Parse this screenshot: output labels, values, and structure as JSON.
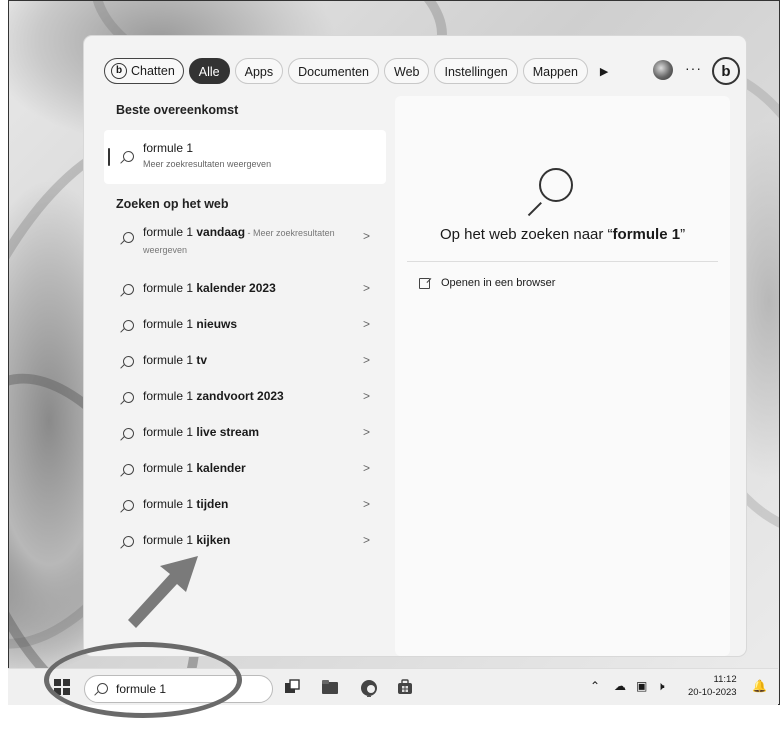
{
  "filters": {
    "chat": "Chatten",
    "chips": [
      "Alle",
      "Apps",
      "Documenten",
      "Web",
      "Instellingen",
      "Mappen"
    ]
  },
  "left": {
    "best_heading": "Beste overeenkomst",
    "best": {
      "title": "formule 1",
      "subtitle": "Meer zoekresultaten weergeven"
    },
    "web_heading": "Zoeken op het web",
    "suggestions": [
      {
        "prefix": "formule 1 ",
        "bold": "vandaag",
        "suffix": " - Meer zoekresultaten weergeven"
      },
      {
        "prefix": "formule 1 ",
        "bold": "kalender 2023"
      },
      {
        "prefix": "formule 1 ",
        "bold": "nieuws"
      },
      {
        "prefix": "formule 1 ",
        "bold": "tv"
      },
      {
        "prefix": "formule 1 ",
        "bold": "zandvoort 2023"
      },
      {
        "prefix": "formule 1 ",
        "bold": "live stream"
      },
      {
        "prefix": "formule 1 ",
        "bold": "kalender"
      },
      {
        "prefix": "formule 1 ",
        "bold": "tijden"
      },
      {
        "prefix": "formule 1 ",
        "bold": "kijken"
      }
    ]
  },
  "right": {
    "title_prefix": "Op het web zoeken naar “",
    "title_query": "formule 1",
    "title_suffix": "”",
    "open_browser": "Openen in een browser"
  },
  "taskbar": {
    "search_value": "formule 1",
    "time": "11:12",
    "date": "20-10-2023"
  }
}
